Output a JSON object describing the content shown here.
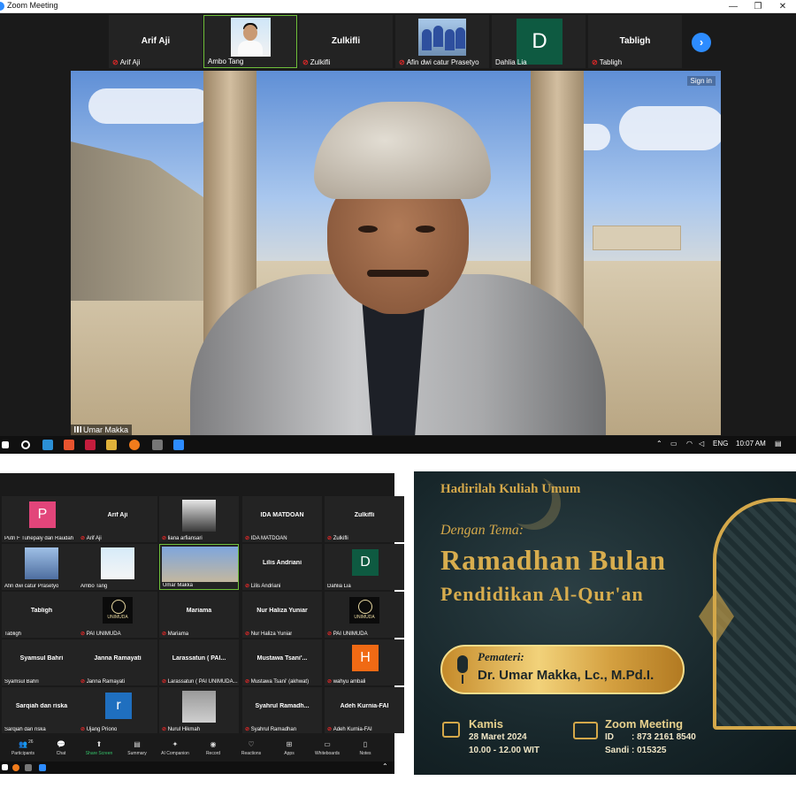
{
  "window": {
    "title": "Zoom Meeting",
    "controls": [
      "—",
      "❐",
      "✕"
    ]
  },
  "top_strip": {
    "tiles": [
      {
        "display": "Arif Aji",
        "label": "Arif Aji",
        "type": "name"
      },
      {
        "display": "",
        "label": "Ambo Tang",
        "type": "photo"
      },
      {
        "display": "Zulkifli",
        "label": "Zulkifli",
        "type": "name"
      },
      {
        "display": "",
        "label": "Afin dwi catur Prasetyo",
        "type": "group"
      },
      {
        "display": "D",
        "label": "Dahlia Lia",
        "type": "letter",
        "color": "#0e5a41"
      },
      {
        "display": "Tabligh",
        "label": "Tabligh",
        "type": "name"
      }
    ],
    "next_icon": "›"
  },
  "speaker": {
    "name": "Umar Makka",
    "sign_in": "Sign in"
  },
  "taskbar": {
    "lang": "ENG",
    "time": "10:07 AM"
  },
  "gallery": {
    "tiles": [
      {
        "name": "P",
        "label": "Putri F Tuhepaly dan Raudah",
        "type": "letter",
        "color": "#e2457a",
        "mic": false
      },
      {
        "name": "Arif Aji",
        "label": "Arif Aji",
        "type": "name",
        "mic": true
      },
      {
        "name": "",
        "label": "liana arfiansari",
        "type": "photo-dark",
        "mic": true
      },
      {
        "name": "IDA MATDOAN",
        "label": "IDA MATDOAN",
        "type": "name",
        "mic": true
      },
      {
        "name": "Zulkifli",
        "label": "Zulkifli",
        "type": "name",
        "mic": true
      },
      {
        "name": "",
        "label": "Afin dwi catur Prasetyo",
        "type": "group",
        "mic": false
      },
      {
        "name": "",
        "label": "Ambo Tang",
        "type": "photo",
        "mic": false
      },
      {
        "name": "",
        "label": "Umar Makka",
        "type": "speaker",
        "mic": false
      },
      {
        "name": "Lilis Andriani",
        "label": "Lilis Andriani",
        "type": "name",
        "mic": true
      },
      {
        "name": "D",
        "label": "Dahlia Lia",
        "type": "letter",
        "color": "#0e5a41",
        "mic": false
      },
      {
        "name": "Tabligh",
        "label": "Tabligh",
        "type": "name",
        "mic": false
      },
      {
        "name": "UNIMUDA",
        "label": "PAI UNIMUDA",
        "type": "logo",
        "mic": true
      },
      {
        "name": "Mariama",
        "label": "Mariama",
        "type": "name",
        "mic": true
      },
      {
        "name": "Nur Haliza Yuniar",
        "label": "Nur Haliza Yuniar",
        "type": "name",
        "mic": true
      },
      {
        "name": "UNIMUDA",
        "label": "PAI UNIMUDA",
        "type": "logo",
        "mic": true
      },
      {
        "name": "Syamsul Bahri",
        "label": "Syamsul Bahri",
        "type": "name",
        "mic": false
      },
      {
        "name": "Janna Ramayati",
        "label": "Janna Ramayati",
        "type": "name",
        "mic": true
      },
      {
        "name": "Larassatun ( PAI...",
        "label": "Larassatun ( PAI UNIMUDA...",
        "type": "name",
        "mic": true
      },
      {
        "name": "Mustawa Tsani'...",
        "label": "Mustawa Tsani' (akhwat)",
        "type": "name",
        "mic": true
      },
      {
        "name": "H",
        "label": "wahyu ambali",
        "type": "letter",
        "color": "#f06a14",
        "mic": true
      },
      {
        "name": "Sarqiah dan riska",
        "label": "Sarqiah dan riska",
        "type": "name",
        "mic": false
      },
      {
        "name": "r",
        "label": "Ujang Priono",
        "type": "letter",
        "color": "#1f6fbf",
        "mic": true
      },
      {
        "name": "",
        "label": "Nurul Hikmah",
        "type": "photo-gray",
        "mic": true
      },
      {
        "name": "Syahrul Ramadh...",
        "label": "Syahrul Ramadhan",
        "type": "name",
        "mic": true
      },
      {
        "name": "Adeh Kurnia-FAI",
        "label": "Adeh Kurnia-FAI",
        "type": "name",
        "mic": true
      }
    ],
    "toolbar": [
      {
        "icon": "👥",
        "label": "Participants",
        "count": "26"
      },
      {
        "icon": "💬",
        "label": "Chat"
      },
      {
        "icon": "⬆",
        "label": "Share Screen",
        "accent": true
      },
      {
        "icon": "▤",
        "label": "Summary"
      },
      {
        "icon": "✦",
        "label": "AI Companion"
      },
      {
        "icon": "◉",
        "label": "Record"
      },
      {
        "icon": "♡",
        "label": "Reactions"
      },
      {
        "icon": "⊞",
        "label": "Apps"
      },
      {
        "icon": "▭",
        "label": "Whiteboards"
      },
      {
        "icon": "▯",
        "label": "Notes"
      }
    ]
  },
  "poster": {
    "heading": "Hadirilah Kuliah Umum",
    "tema": "Dengan Tema:",
    "title_line1": "Ramadhan Bulan",
    "title_line2": "Pendidikan Al-Qur'an",
    "pemateri_label": "Pemateri:",
    "speaker": "Dr. Umar Makka, Lc., M.Pd.I.",
    "day": "Kamis",
    "date": "28 Maret 2024",
    "time": "10.00 - 12.00 WIT",
    "platform": "Zoom Meeting",
    "meeting_id_label": "ID",
    "meeting_id": ": 873 2161 8540",
    "passcode_label": "Sandi",
    "passcode": ": 015325",
    "colors": {
      "gold": "#d4a84a",
      "background": "#17262a"
    }
  }
}
